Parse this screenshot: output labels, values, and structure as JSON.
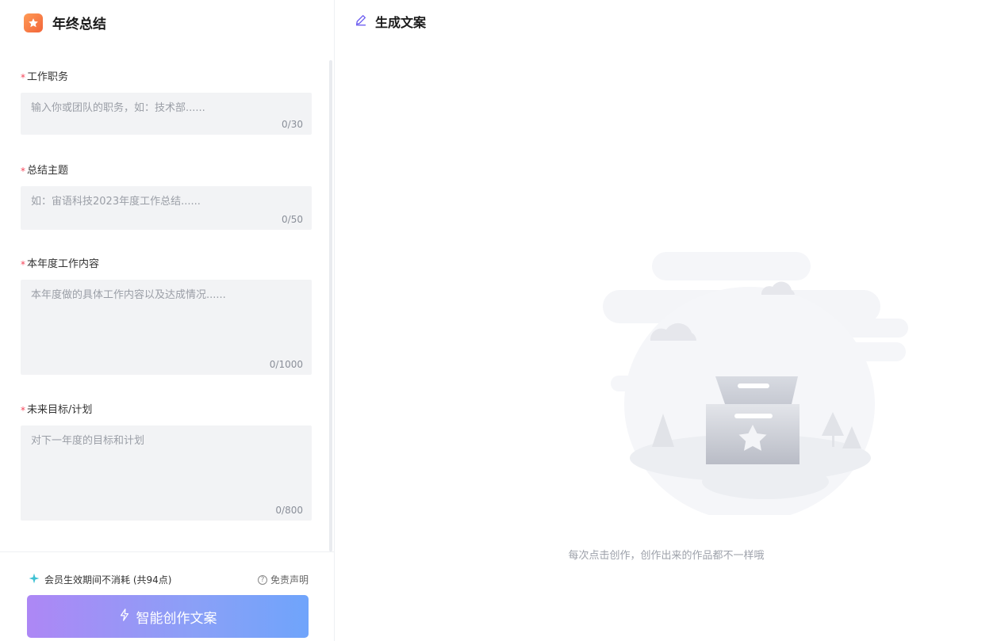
{
  "app": {
    "title": "年终总结"
  },
  "form": {
    "fields": [
      {
        "label": "工作职务",
        "placeholder": "输入你或团队的职务，如：技术部......",
        "counter": "0/30"
      },
      {
        "label": "总结主题",
        "placeholder": "如：宙语科技2023年度工作总结......",
        "counter": "0/50"
      },
      {
        "label": "本年度工作内容",
        "placeholder": "本年度做的具体工作内容以及达成情况......",
        "counter": "0/1000"
      },
      {
        "label": "未来目标/计划",
        "placeholder": "对下一年度的目标和计划",
        "counter": "0/800"
      }
    ],
    "required_mark": "*"
  },
  "footer": {
    "member_text": "会员生效期间不消耗 (共94点)",
    "disclaimer": "免责声明",
    "create_button": "智能创作文案"
  },
  "result": {
    "title": "生成文案",
    "empty_text": "每次点击创作，创作出来的作品都不一样哦"
  },
  "colors": {
    "accent_start": "#ad87f5",
    "accent_end": "#6fa4fb",
    "required": "#f5465a",
    "logo": "#f2653a"
  }
}
